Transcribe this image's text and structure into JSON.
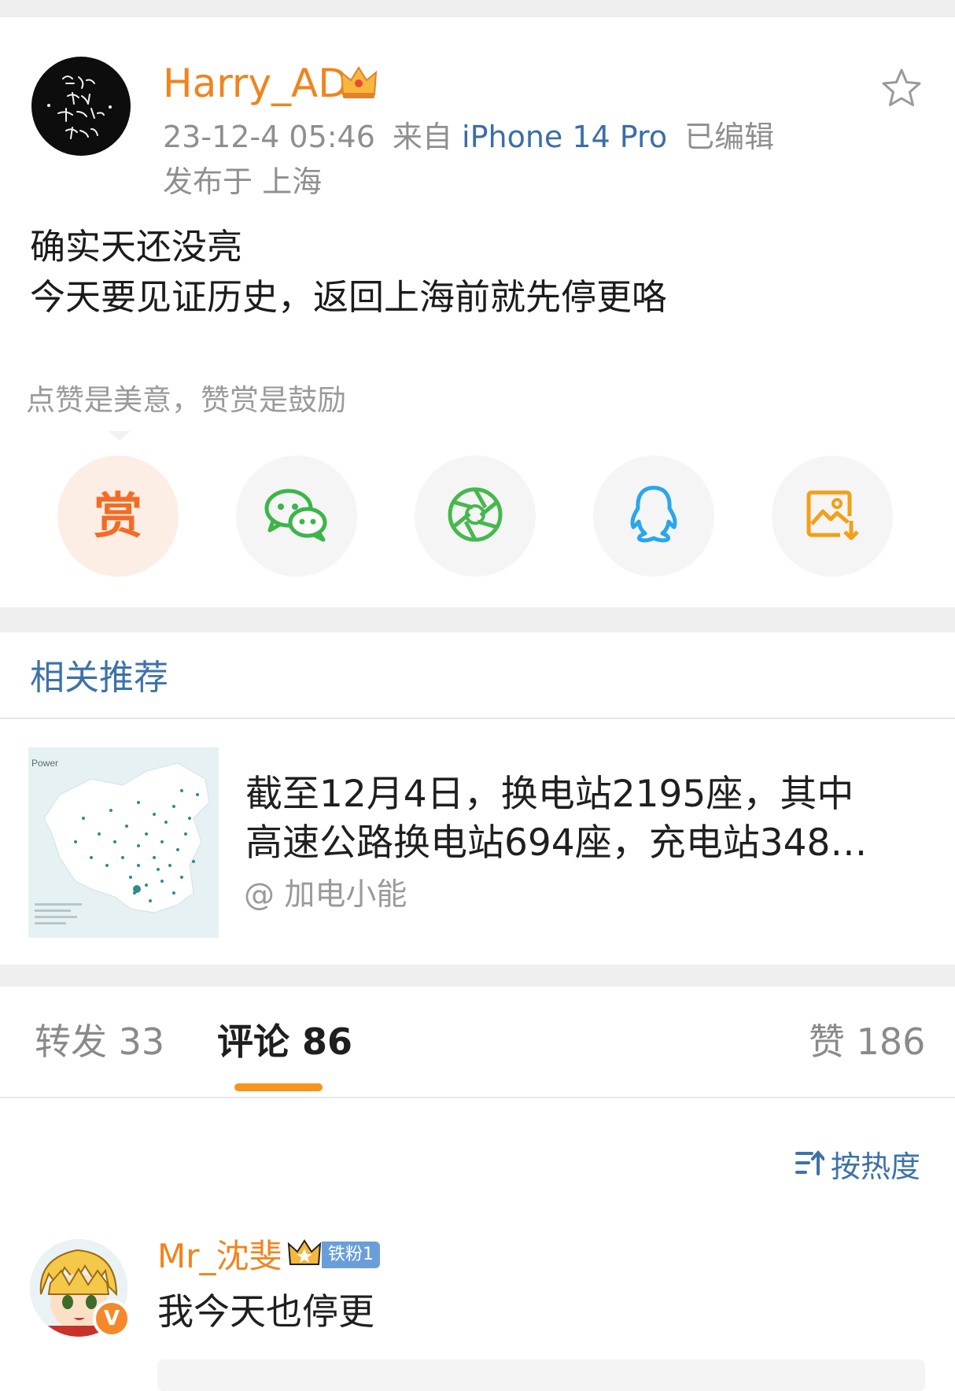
{
  "post": {
    "username": "Harry_AD",
    "time": "23-12-4 05:46",
    "from_label": "来自",
    "device": "iPhone 14 Pro",
    "edited": "已编辑",
    "location": "发布于 上海",
    "avatar_text": [
      "宇宙的",
      "有趣",
      "我才不",
      "在意"
    ],
    "body": [
      "确实天还没亮",
      "今天要见证历史，返回上海前就先停更咯"
    ]
  },
  "reward": {
    "tip": "点赞是美意，赞赏是鼓励",
    "reward_label": "赏",
    "share_icons": [
      "wechat-icon",
      "moments-icon",
      "qq-icon",
      "save-image-icon"
    ]
  },
  "related": {
    "title": "相关推荐",
    "thumb_label": "Power",
    "text_lines": [
      "截至12月4日，换电站2195座，其中",
      "高速公路换电站694座，充电站348…"
    ],
    "source": "@ 加电小能"
  },
  "tabs": [
    {
      "label": "转发 33",
      "active": false
    },
    {
      "label": "评论 86",
      "active": true
    },
    {
      "label": "赞 186",
      "active": false
    }
  ],
  "sort": {
    "label": "按热度"
  },
  "comment": {
    "name": "Mr_沈斐",
    "badge": "铁粉1",
    "verify": "V",
    "text": "我今天也停更"
  },
  "colors": {
    "accent": "#f0841d",
    "link": "#3d72a8",
    "tab_underline": "#f7931e"
  }
}
